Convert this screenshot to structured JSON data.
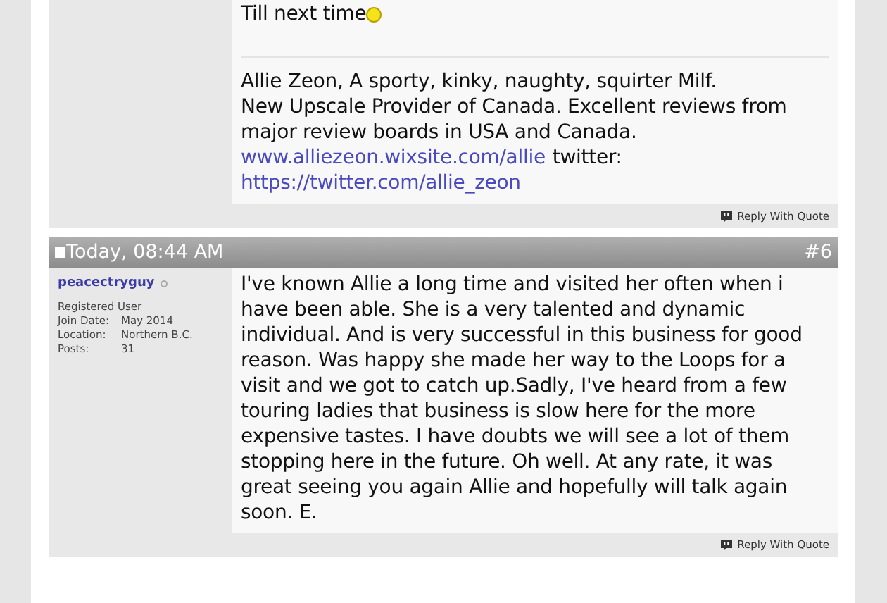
{
  "posts": [
    {
      "message": [
        "Till next time"
      ],
      "smiley": true,
      "signature": [
        [
          {
            "kind": "text",
            "text": "Allie Zeon, A sporty, kinky, naughty, squirter Milf."
          }
        ],
        [
          {
            "kind": "text",
            "text": "New Upscale Provider of Canada. Excellent reviews from major review boards in USA and Canada."
          }
        ],
        [
          {
            "kind": "link",
            "text": "www.alliezeon.wixsite.com/allie"
          },
          {
            "kind": "text",
            "text": "twitter:"
          }
        ],
        [
          {
            "kind": "link",
            "text": "https://twitter.com/allie_zeon"
          }
        ]
      ],
      "reply_button": "Reply With Quote"
    },
    {
      "date": "Today, 08:44 AM",
      "number": "#6",
      "user": {
        "name": "peacectryguy",
        "online": false,
        "title": "Registered User",
        "details": [
          {
            "label": "Join Date:",
            "value": "May 2014"
          },
          {
            "label": "Location:",
            "value": "Northern B.C."
          },
          {
            "label": "Posts:",
            "value": "31"
          }
        ]
      },
      "message": [
        "I've known Allie a long time and visited her often when i have been able. She is a very talented and dynamic individual. And is very successful in this business for good reason. Was happy she made her way to the Loops for a visit and we got to catch up.Sadly, I've heard from a few touring ladies that business is slow here for the more expensive tastes. I have doubts we will see a lot of them stopping here in the future. Oh well. At any rate, it was great seeing you again Allie and hopefully will talk again soon. E."
      ],
      "reply_button": "Reply With Quote"
    }
  ]
}
